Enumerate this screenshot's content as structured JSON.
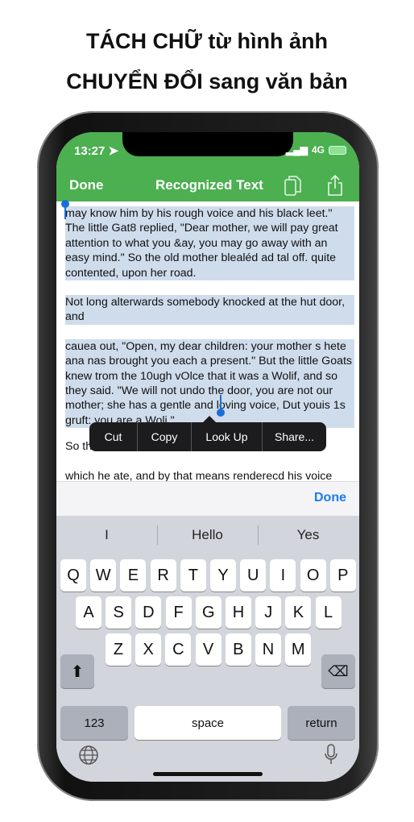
{
  "headline": {
    "line1": "TÁCH CHỮ từ hình ảnh",
    "line2": "CHUYỂN ĐỔI sang văn bản"
  },
  "status": {
    "time": "13:27",
    "network": "4G"
  },
  "nav": {
    "done": "Done",
    "title": "Recognized Text",
    "copy_icon": "copy-icon",
    "share_icon": "share-icon"
  },
  "colors": {
    "header": "#4caf50",
    "selection": "#cfdcec",
    "accent": "#1a7cf5"
  },
  "text": {
    "p1": "may know him by his rough voice and his black leet.\" The little Gat8 replied, \"Dear mother, we will pay great attention to what you &ay, you may go away with an easy mind.\" So the old mother blealéd ad tal off. quite contented, upon her road.",
    "p2": "Not long alterwards somebody knocked at the hut door, and",
    "p3": "cauea out, \"Open, my dear children: your mother s hete ana nas brought you each a present.\" But the little Goats knew trom the 10ugh vOlce that it was a Wolif, and so they said. \"We will not undo the door, you are not our mother; she has a gentle and loving voice, Dut youis 1s gruft: you are a Woli.\"",
    "p4": "So th                                                       0e of ch",
    "p5": "which he ate, and by that means renderecd his voice"
  },
  "context_menu": [
    "Cut",
    "Copy",
    "Look Up",
    "Share..."
  ],
  "toolbar": {
    "done": "Done"
  },
  "keyboard": {
    "suggestions": [
      "I",
      "Hello",
      "Yes"
    ],
    "row1": [
      "Q",
      "W",
      "E",
      "R",
      "T",
      "Y",
      "U",
      "I",
      "O",
      "P"
    ],
    "row2": [
      "A",
      "S",
      "D",
      "F",
      "G",
      "H",
      "J",
      "K",
      "L"
    ],
    "row3": [
      "Z",
      "X",
      "C",
      "V",
      "B",
      "N",
      "M"
    ],
    "numbers": "123",
    "space": "space",
    "return": "return"
  }
}
